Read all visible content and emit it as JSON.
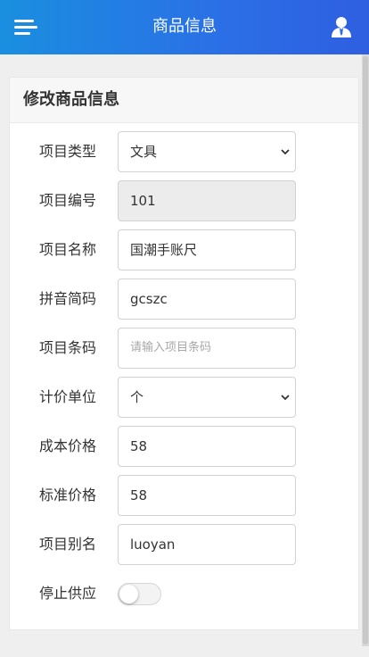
{
  "header": {
    "title": "商品信息",
    "menu_icon": "hamburger-menu-icon",
    "user_icon": "user-icon",
    "gradient_start": "#1a8fe0",
    "gradient_end": "#2e5fe0"
  },
  "form": {
    "title": "修改商品信息",
    "fields": [
      {
        "label": "项目类型",
        "type": "select",
        "value": "文具"
      },
      {
        "label": "项目编号",
        "type": "readonly",
        "value": "101"
      },
      {
        "label": "项目名称",
        "type": "input",
        "value": "国潮手账尺"
      },
      {
        "label": "拼音简码",
        "type": "input",
        "value": "gcszc"
      },
      {
        "label": "项目条码",
        "type": "input",
        "value": "",
        "placeholder": "请输入项目条码"
      },
      {
        "label": "计价单位",
        "type": "select",
        "value": "个"
      },
      {
        "label": "成本价格",
        "type": "input",
        "value": "58"
      },
      {
        "label": "标准价格",
        "type": "input",
        "value": "58"
      },
      {
        "label": "项目别名",
        "type": "input",
        "value": "luoyan"
      }
    ],
    "stop_supply": {
      "label": "停止供应",
      "value": "off"
    }
  }
}
